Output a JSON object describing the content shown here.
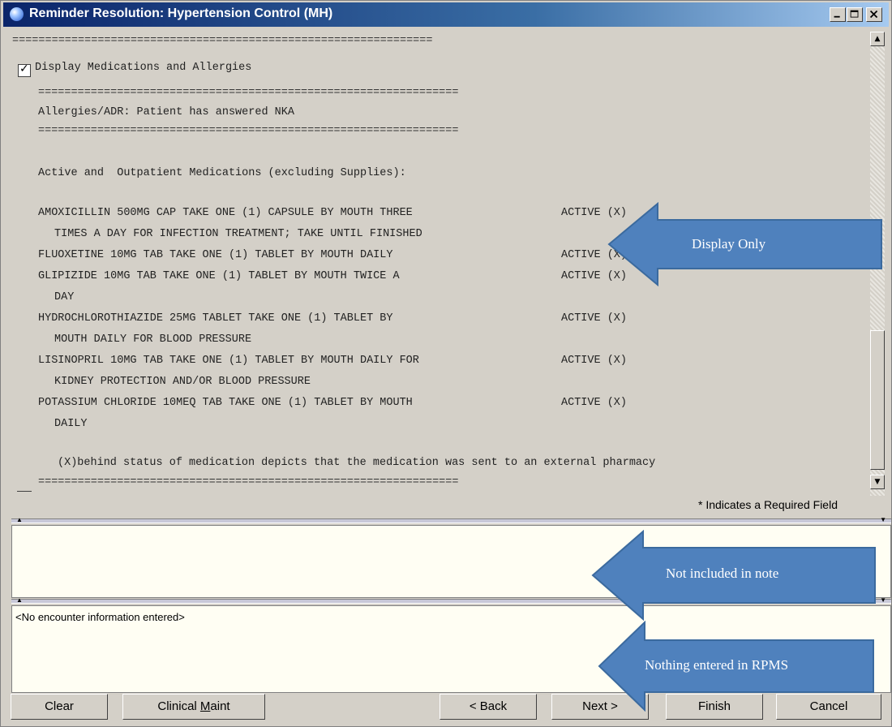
{
  "window": {
    "title": "Reminder Resolution: Hypertension Control (MH)",
    "app_icon": "globe-icon",
    "controls": [
      "minimize-icon",
      "maximize-icon",
      "close-icon"
    ]
  },
  "content": {
    "separator": "================================================================",
    "checkbox": {
      "checked": true,
      "label": "Display Medications and Allergies"
    },
    "allergy_line": "Allergies/ADR: Patient has answered NKA",
    "section_header": "Active and  Outpatient Medications (excluding Supplies):",
    "medications": [
      {
        "line1": "AMOXICILLIN 500MG CAP TAKE ONE (1) CAPSULE BY MOUTH THREE",
        "status": "ACTIVE (X)",
        "line2": "TIMES A DAY FOR INFECTION TREATMENT; TAKE UNTIL FINISHED"
      },
      {
        "line1": "FLUOXETINE 10MG TAB TAKE ONE (1) TABLET BY MOUTH DAILY",
        "status": "ACTIVE (X)",
        "line2": ""
      },
      {
        "line1": "GLIPIZIDE 10MG TAB TAKE ONE (1) TABLET BY MOUTH TWICE A",
        "status": "ACTIVE (X)",
        "line2": "DAY"
      },
      {
        "line1": "HYDROCHLOROTHIAZIDE 25MG TABLET TAKE ONE (1) TABLET BY",
        "status": "ACTIVE (X)",
        "line2": "MOUTH DAILY FOR BLOOD PRESSURE"
      },
      {
        "line1": "LISINOPRIL 10MG TAB TAKE ONE (1) TABLET BY MOUTH DAILY FOR",
        "status": "ACTIVE (X)",
        "line2": "KIDNEY PROTECTION AND/OR BLOOD PRESSURE"
      },
      {
        "line1": "POTASSIUM CHLORIDE 10MEQ TAB TAKE ONE (1) TABLET BY MOUTH",
        "status": "ACTIVE (X)",
        "line2": "DAILY"
      }
    ],
    "footnote": "(X)behind status of medication depicts that the medication was sent to an external pharmacy"
  },
  "required_note": "* Indicates a Required Field",
  "encounter_text": "<No encounter information entered>",
  "callouts": {
    "display_only": "Display Only",
    "not_included": "Not included in note",
    "nothing_entered": "Nothing entered in RPMS"
  },
  "buttons": {
    "clear": "Clear",
    "clinical_maint_prefix": "Clinical ",
    "clinical_maint_hotkey": "M",
    "clinical_maint_suffix": "aint",
    "back": "< Back",
    "next": "Next >",
    "finish": "Finish",
    "cancel": "Cancel"
  },
  "colors": {
    "title_bar": "#0a246a",
    "callout_fill": "#4f81bd",
    "pane_background": "#fffef3"
  }
}
